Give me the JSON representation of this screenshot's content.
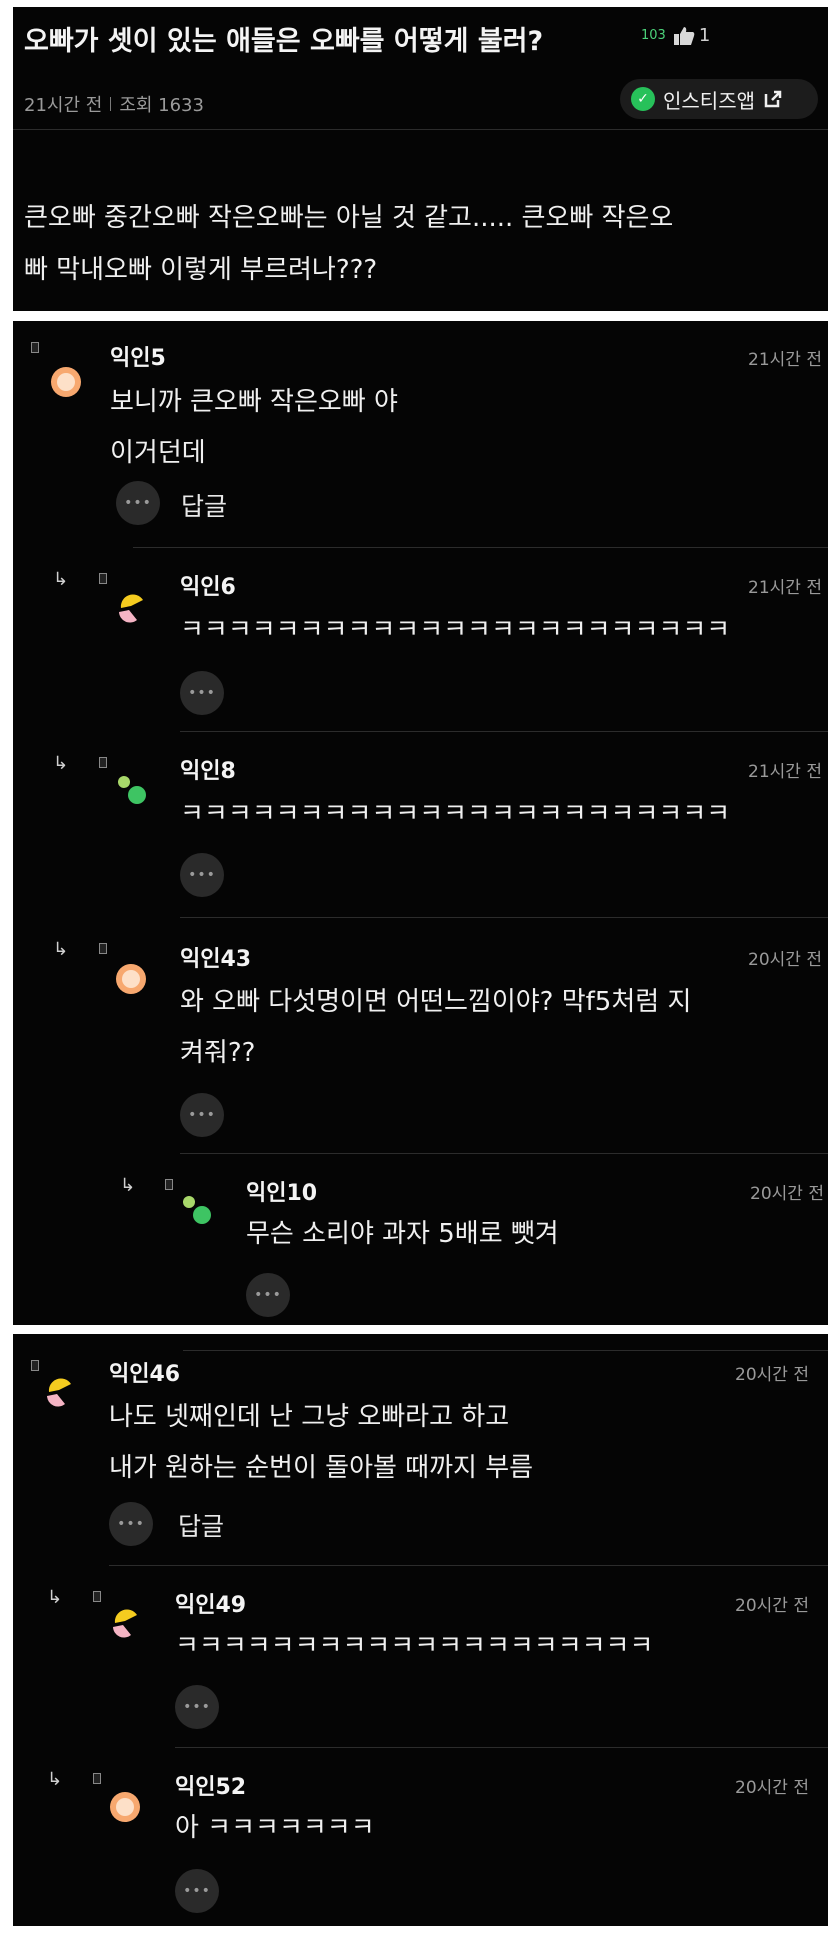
{
  "post": {
    "title": "오빠가 셋이 있는 애들은 오빠를 어떻게 불러?",
    "likes_count": "103",
    "likes_extra": "1",
    "time": "21시간 전",
    "views": "조회 1633",
    "app_button": "인스티즈앱",
    "body_lines": [
      "큰오빠 중간오빠 작은오빠는 아닐 것 같고..... 큰오빠 작은오",
      "빠 막내오빠 이렇게 부르려나???"
    ]
  },
  "comments": [
    {
      "name": "익인5",
      "time": "21시간 전",
      "lines": [
        "보니까 큰오빠 작은오빠 야",
        "이거던데"
      ],
      "reply_label": "답글",
      "avatar": "orange-face"
    },
    {
      "name": "익인6",
      "time": "21시간 전",
      "lines": [
        "ㅋㅋㅋㅋㅋㅋㅋㅋㅋㅋㅋㅋㅋㅋㅋㅋㅋㅋㅋㅋㅋㅋㅋ"
      ],
      "avatar": "yellow-pink-split"
    },
    {
      "name": "익인8",
      "time": "21시간 전",
      "lines": [
        "ㅋㅋㅋㅋㅋㅋㅋㅋㅋㅋㅋㅋㅋㅋㅋㅋㅋㅋㅋㅋㅋㅋㅋ"
      ],
      "avatar": "green-dots"
    },
    {
      "name": "익인43",
      "time": "20시간 전",
      "lines": [
        "와 오빠 다섯명이면 어떤느낌이야? 막f5처럼 지",
        "켜줘??"
      ],
      "avatar": "orange-face"
    },
    {
      "name": "익인10",
      "time": "20시간 전",
      "lines": [
        "무슨 소리야 과자 5배로 뺏겨"
      ],
      "avatar": "green-dots"
    },
    {
      "name": "익인46",
      "time": "20시간 전",
      "lines": [
        "나도 넷째인데 난 그냥 오빠라고 하고",
        "내가 원하는 순번이 돌아볼 때까지 부름"
      ],
      "reply_label": "답글",
      "avatar": "yellow-pink-split"
    },
    {
      "name": "익인49",
      "time": "20시간 전",
      "lines": [
        "ㅋㅋㅋㅋㅋㅋㅋㅋㅋㅋㅋㅋㅋㅋㅋㅋㅋㅋㅋㅋ"
      ],
      "avatar": "yellow-pink-split"
    },
    {
      "name": "익인52",
      "time": "20시간 전",
      "lines": [
        "아 ㅋㅋㅋㅋㅋㅋㅋ"
      ],
      "avatar": "orange-face"
    }
  ],
  "colors": {
    "background": "#050505",
    "accent_green": "#27c15a",
    "text": "#f0f0f0",
    "muted": "#9a9a9a"
  }
}
